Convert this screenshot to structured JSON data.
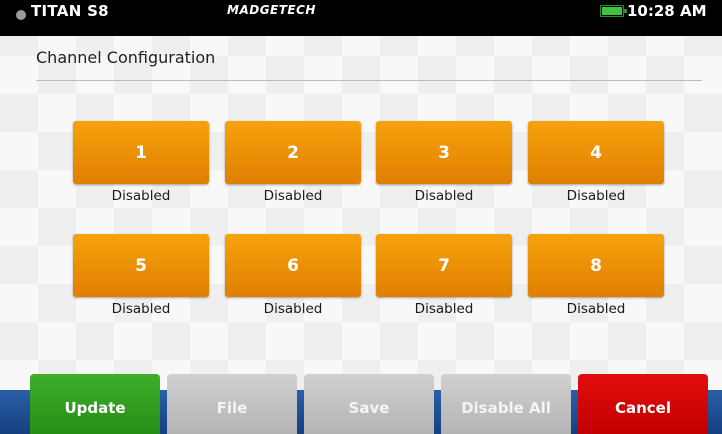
{
  "status_bar": {
    "device_name": "TITAN S8",
    "brand": "MADGETECH",
    "time": "10:28 AM",
    "battery_color": "#3cc43c"
  },
  "page": {
    "title": "Channel Configuration"
  },
  "channels": [
    {
      "number": "1",
      "state": "Disabled"
    },
    {
      "number": "2",
      "state": "Disabled"
    },
    {
      "number": "3",
      "state": "Disabled"
    },
    {
      "number": "4",
      "state": "Disabled"
    },
    {
      "number": "5",
      "state": "Disabled"
    },
    {
      "number": "6",
      "state": "Disabled"
    },
    {
      "number": "7",
      "state": "Disabled"
    },
    {
      "number": "8",
      "state": "Disabled"
    }
  ],
  "actions": {
    "update": "Update",
    "file": "File",
    "save": "Save",
    "disable_all": "Disable All",
    "cancel": "Cancel"
  },
  "colors": {
    "channel_button": "#f09208",
    "update": "#34a021",
    "inactive": "#c2c2c2",
    "cancel": "#d60606",
    "navbar": "#1f4f95"
  }
}
